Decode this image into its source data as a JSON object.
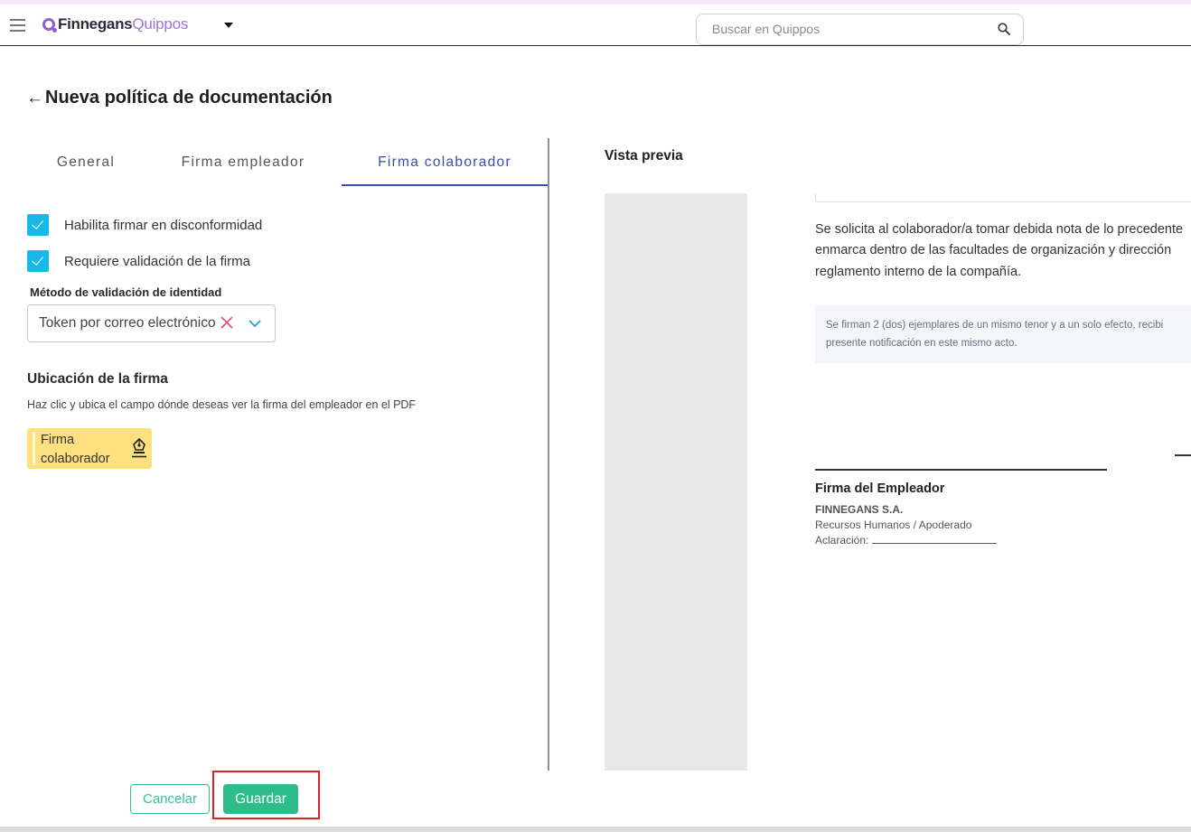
{
  "header": {
    "logo_primary": "Finnegans",
    "logo_secondary": "Quippos",
    "search_placeholder": "Buscar en Quippos"
  },
  "page": {
    "title": "Nueva política de documentación"
  },
  "tabs": [
    {
      "label": "General",
      "active": false
    },
    {
      "label": "Firma empleador",
      "active": false
    },
    {
      "label": "Firma colaborador",
      "active": true
    }
  ],
  "form": {
    "checkboxes": [
      {
        "label": "Habilita firmar en disconformidad",
        "checked": true
      },
      {
        "label": "Requiere validación de la firma",
        "checked": true
      }
    ],
    "validation_method_label": "Método de validación de identidad",
    "validation_method_value": "Token por correo electrónico",
    "location_title": "Ubicación de la firma",
    "location_desc": "Haz clic y ubica el campo dónde deseas ver la firma del empleador en el PDF",
    "signature_chip_line1": "Firma",
    "signature_chip_line2": "colaborador"
  },
  "preview": {
    "title": "Vista previa",
    "paragraph_lines": [
      "Se solicita al colaborador/a tomar debida nota de lo precedente",
      "enmarca dentro de las facultades de organización y dirección",
      "reglamento interno de la compañía."
    ],
    "box_lines": [
      "Se firman 2 (dos) ejemplares de un mismo tenor y a un solo efecto, recibi",
      "presente notificación en este mismo acto."
    ],
    "signature_title": "Firma del Empleador",
    "company": "FINNEGANS S.A.",
    "role": "Recursos Humanos / Apoderado",
    "clarification_label": "Aclaración:"
  },
  "actions": {
    "cancel_label": "Cancelar",
    "save_label": "Guardar"
  },
  "colors": {
    "brand_purple": "#9a76de",
    "active_tab": "#3a4ea8",
    "checkbox": "#16b8e6",
    "primary_button": "#2ebc8a",
    "signature_chip": "#ffe07f",
    "highlight": "#e02020"
  }
}
